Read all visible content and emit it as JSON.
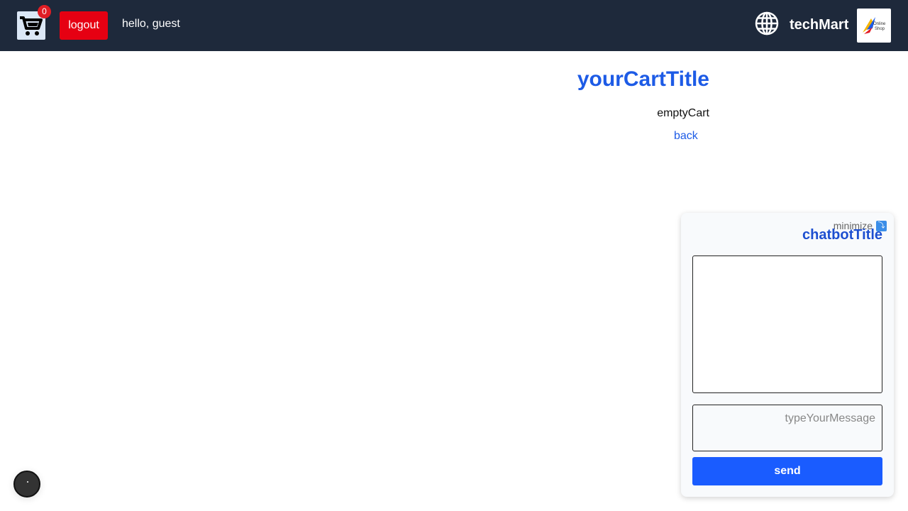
{
  "header": {
    "cart_count": "0",
    "logout_label": "logout",
    "greeting": "hello, guest",
    "brand": "techMart",
    "logo_text": [
      "Online",
      "Shop"
    ]
  },
  "main": {
    "cart_title": "yourCartTitle",
    "empty_text": "emptyCart",
    "back_label": "back"
  },
  "chatbot": {
    "minimize_label": "minimize",
    "title": "chatbotTitle",
    "input_placeholder": "typeYourMessage",
    "send_label": "send"
  },
  "colors": {
    "header_bg": "#1e293b",
    "accent": "#1d5be6",
    "logout": "#e60012",
    "send": "#1a5cff"
  },
  "icons": [
    "cart-icon",
    "globe-icon",
    "logo-icon",
    "minimize-icon"
  ]
}
